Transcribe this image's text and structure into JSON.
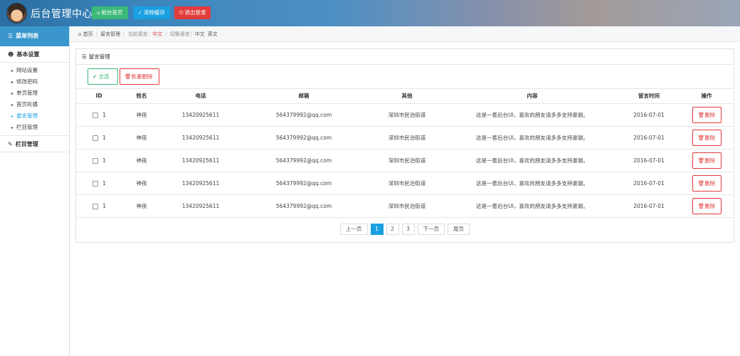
{
  "header": {
    "title": "后台管理中心",
    "buttons": [
      {
        "icon": "home-icon",
        "label": "前台首页",
        "color": "#3cb878"
      },
      {
        "icon": "wrench-icon",
        "label": "清除缓存",
        "color": "#1aa0e0"
      },
      {
        "icon": "power-icon",
        "label": "退出登录",
        "color": "#e23b3b"
      }
    ]
  },
  "sidebar": {
    "title": "菜单列表",
    "groups": [
      {
        "label": "基本设置",
        "icon": "user-icon",
        "items": [
          "网站设置",
          "修改密码",
          "单页管理",
          "首页轮播",
          "留言管理",
          "栏目管理"
        ]
      },
      {
        "label": "栏目管理",
        "icon": "edit-icon"
      }
    ]
  },
  "breadcrumb": {
    "home": "首页",
    "current": "留言管理",
    "lang_label": "当前语言：",
    "lang_value": "中文",
    "switch_label": "切换语言：",
    "opt_cn": "中文",
    "opt_en": "英文"
  },
  "panel": {
    "title": "留言管理",
    "select_all": "全选",
    "batch_delete": "批量删除"
  },
  "table": {
    "headers": [
      "ID",
      "姓名",
      "电话",
      "邮箱",
      "其他",
      "内容",
      "留言时间",
      "操作"
    ],
    "delete_label": "删除",
    "rows": [
      {
        "id": "1",
        "name": "神夜",
        "phone": "13420925611",
        "email": "564379992@qq.com",
        "other": "深圳市民治街道",
        "content": "这是一套后台UI，喜欢的朋友请多多支持谢谢。",
        "time": "2016-07-01"
      },
      {
        "id": "1",
        "name": "神夜",
        "phone": "13420925611",
        "email": "564379992@qq.com",
        "other": "深圳市民治街道",
        "content": "这是一套后台UI，喜欢的朋友请多多支持谢谢。",
        "time": "2016-07-01"
      },
      {
        "id": "1",
        "name": "神夜",
        "phone": "13420925611",
        "email": "564379992@qq.com",
        "other": "深圳市民治街道",
        "content": "这是一套后台UI，喜欢的朋友请多多支持谢谢。",
        "time": "2016-07-01"
      },
      {
        "id": "1",
        "name": "神夜",
        "phone": "13420925611",
        "email": "564379992@qq.com",
        "other": "深圳市民治街道",
        "content": "这是一套后台UI，喜欢的朋友请多多支持谢谢。",
        "time": "2016-07-01"
      },
      {
        "id": "1",
        "name": "神夜",
        "phone": "13420925611",
        "email": "564379992@qq.com",
        "other": "深圳市民治街道",
        "content": "这是一套后台UI，喜欢的朋友请多多支持谢谢。",
        "time": "2016-07-01"
      }
    ]
  },
  "pagination": {
    "prev": "上一页",
    "pages": [
      "1",
      "2",
      "3"
    ],
    "current": "1",
    "next": "下一页",
    "last": "尾页"
  }
}
